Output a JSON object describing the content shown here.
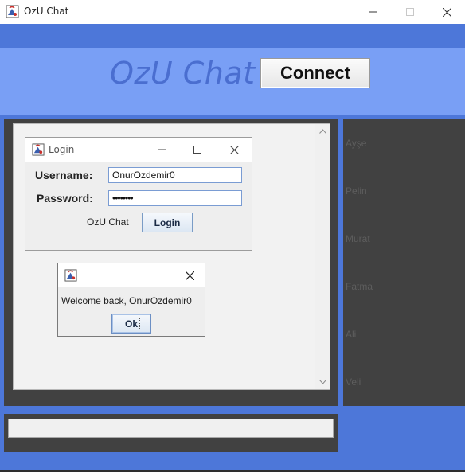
{
  "window": {
    "title": "OzU Chat",
    "icons": {
      "app": "java-app-icon",
      "minimize": "minimize-icon",
      "maximize": "maximize-icon",
      "close": "close-icon"
    }
  },
  "header": {
    "brand": "OzU Chat",
    "connect_label": "Connect"
  },
  "users": [
    "Ayşe",
    "Pelin",
    "Murat",
    "Fatma",
    "Ali",
    "Veli"
  ],
  "message_input": {
    "value": ""
  },
  "login_dialog": {
    "title": "Login",
    "username_label": "Username:",
    "username_value": "OnurOzdemir0",
    "password_label": "Password:",
    "password_masked": "••••••••",
    "caption": "OzU Chat",
    "login_label": "Login"
  },
  "welcome_dialog": {
    "message": "Welcome back, OnurOzdemir0",
    "ok_label": "Ok"
  },
  "colors": {
    "accent_blue": "#4d77d9",
    "header_blue": "#799ff5",
    "brand_text": "#4a6ed0",
    "panel_dark": "#414141"
  }
}
